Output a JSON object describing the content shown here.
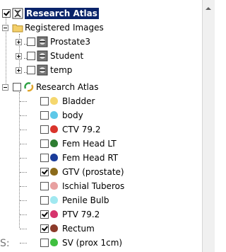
{
  "tree": {
    "root_label": "Research Atlas",
    "registered": {
      "label": "Registered Images",
      "items": [
        "Prostate3",
        "Student",
        "temp"
      ]
    },
    "atlas": {
      "label": "Research Atlas",
      "structures": [
        {
          "label": "Bladder",
          "checked": false,
          "color": "#f5d76e"
        },
        {
          "label": "body",
          "checked": false,
          "color": "#5ec8e8"
        },
        {
          "label": "CTV 79.2",
          "checked": false,
          "color": "#d9342b"
        },
        {
          "label": "Fem Head LT",
          "checked": false,
          "color": "#2e7d32"
        },
        {
          "label": "Fem Head RT",
          "checked": false,
          "color": "#1a3c9a"
        },
        {
          "label": "GTV (prostate)",
          "checked": true,
          "color": "#8b6a1a"
        },
        {
          "label": "Ischial Tuberos",
          "checked": false,
          "color": "#e8a0a0"
        },
        {
          "label": "Penile Bulb",
          "checked": false,
          "color": "#a0e8f0"
        },
        {
          "label": "PTV 79.2",
          "checked": true,
          "color": "#d6336c"
        },
        {
          "label": "Rectum",
          "checked": true,
          "color": "#8b3a2a"
        },
        {
          "label": "SV (prox 1cm)",
          "checked": false,
          "color": "#3fbf3f"
        }
      ]
    }
  },
  "partial_text": "S:"
}
